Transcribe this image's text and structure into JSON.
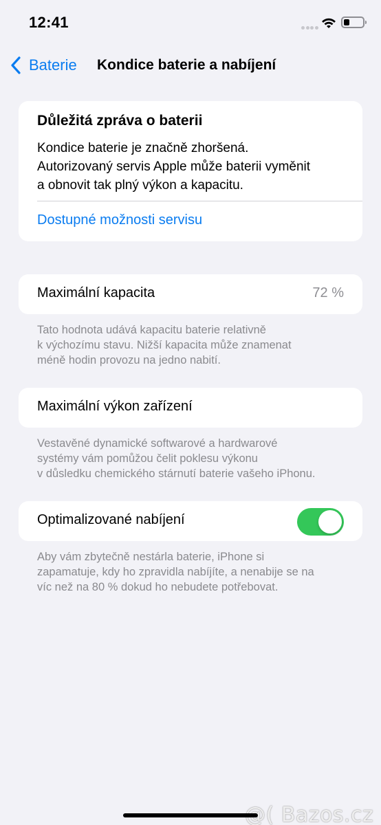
{
  "status_bar": {
    "time": "12:41",
    "battery_icon": "battery-low-icon",
    "wifi_icon": "wifi-icon"
  },
  "nav": {
    "back_label": "Baterie",
    "title": "Kondice baterie a nabíjení"
  },
  "battery_message": {
    "title": "Důležitá zpráva o baterii",
    "body_lines": [
      "Kondice baterie je značně zhoršená.",
      "Autorizovaný servis Apple může baterii vyměnit",
      "a obnovit tak plný výkon a kapacitu."
    ],
    "link": "Dostupné možnosti servisu"
  },
  "max_capacity": {
    "label": "Maximální kapacita",
    "value": "72 %",
    "footnote_lines": [
      "Tato hodnota udává kapacitu baterie relativně",
      "k výchozímu stavu. Nižší kapacita může znamenat",
      "méně hodin provozu na jedno nabití."
    ]
  },
  "peak_performance": {
    "label": "Maximální výkon zařízení",
    "footnote_lines": [
      "Vestavěné dynamické softwarové a hardwarové",
      "systémy vám pomůžou čelit poklesu výkonu",
      "v důsledku chemického stárnutí baterie vašeho iPhonu."
    ]
  },
  "optimized_charging": {
    "label": "Optimalizované nabíjení",
    "enabled": true,
    "footnote_lines": [
      "Aby vám zbytečně nestárla baterie, iPhone si",
      "zapamatuje, kdy ho zpravidla nabíjíte, a nenabije se na",
      "víc než na 80 % dokud ho nebudete potřebovat."
    ]
  },
  "watermark": "@( Bazos.cz",
  "colors": {
    "accent": "#0a7cf0",
    "toggle_on": "#34c759",
    "background": "#f2f2f7",
    "secondary_text": "#8a8a8e"
  }
}
